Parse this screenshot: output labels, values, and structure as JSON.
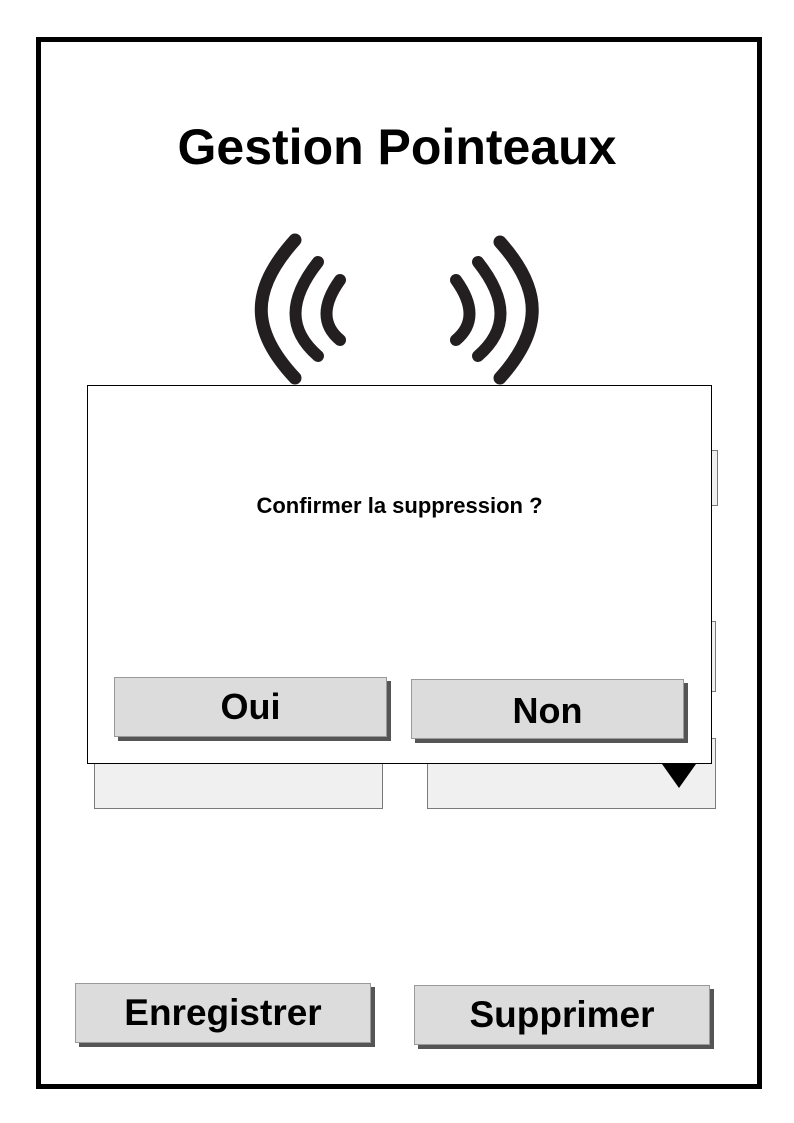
{
  "app": {
    "title": "Gestion Pointeaux"
  },
  "icons": {
    "nfc": "nfc-signal-icon",
    "dropdown": "triangle-down-icon"
  },
  "footer": {
    "save_label": "Enregistrer",
    "delete_label": "Supprimer"
  },
  "dialog": {
    "message": "Confirmer la suppression ?",
    "yes_label": "Oui",
    "no_label": "Non"
  },
  "colors": {
    "frame": "#000000",
    "button_bg": "#dcdcdc",
    "field_bg": "#f0f0f0"
  }
}
